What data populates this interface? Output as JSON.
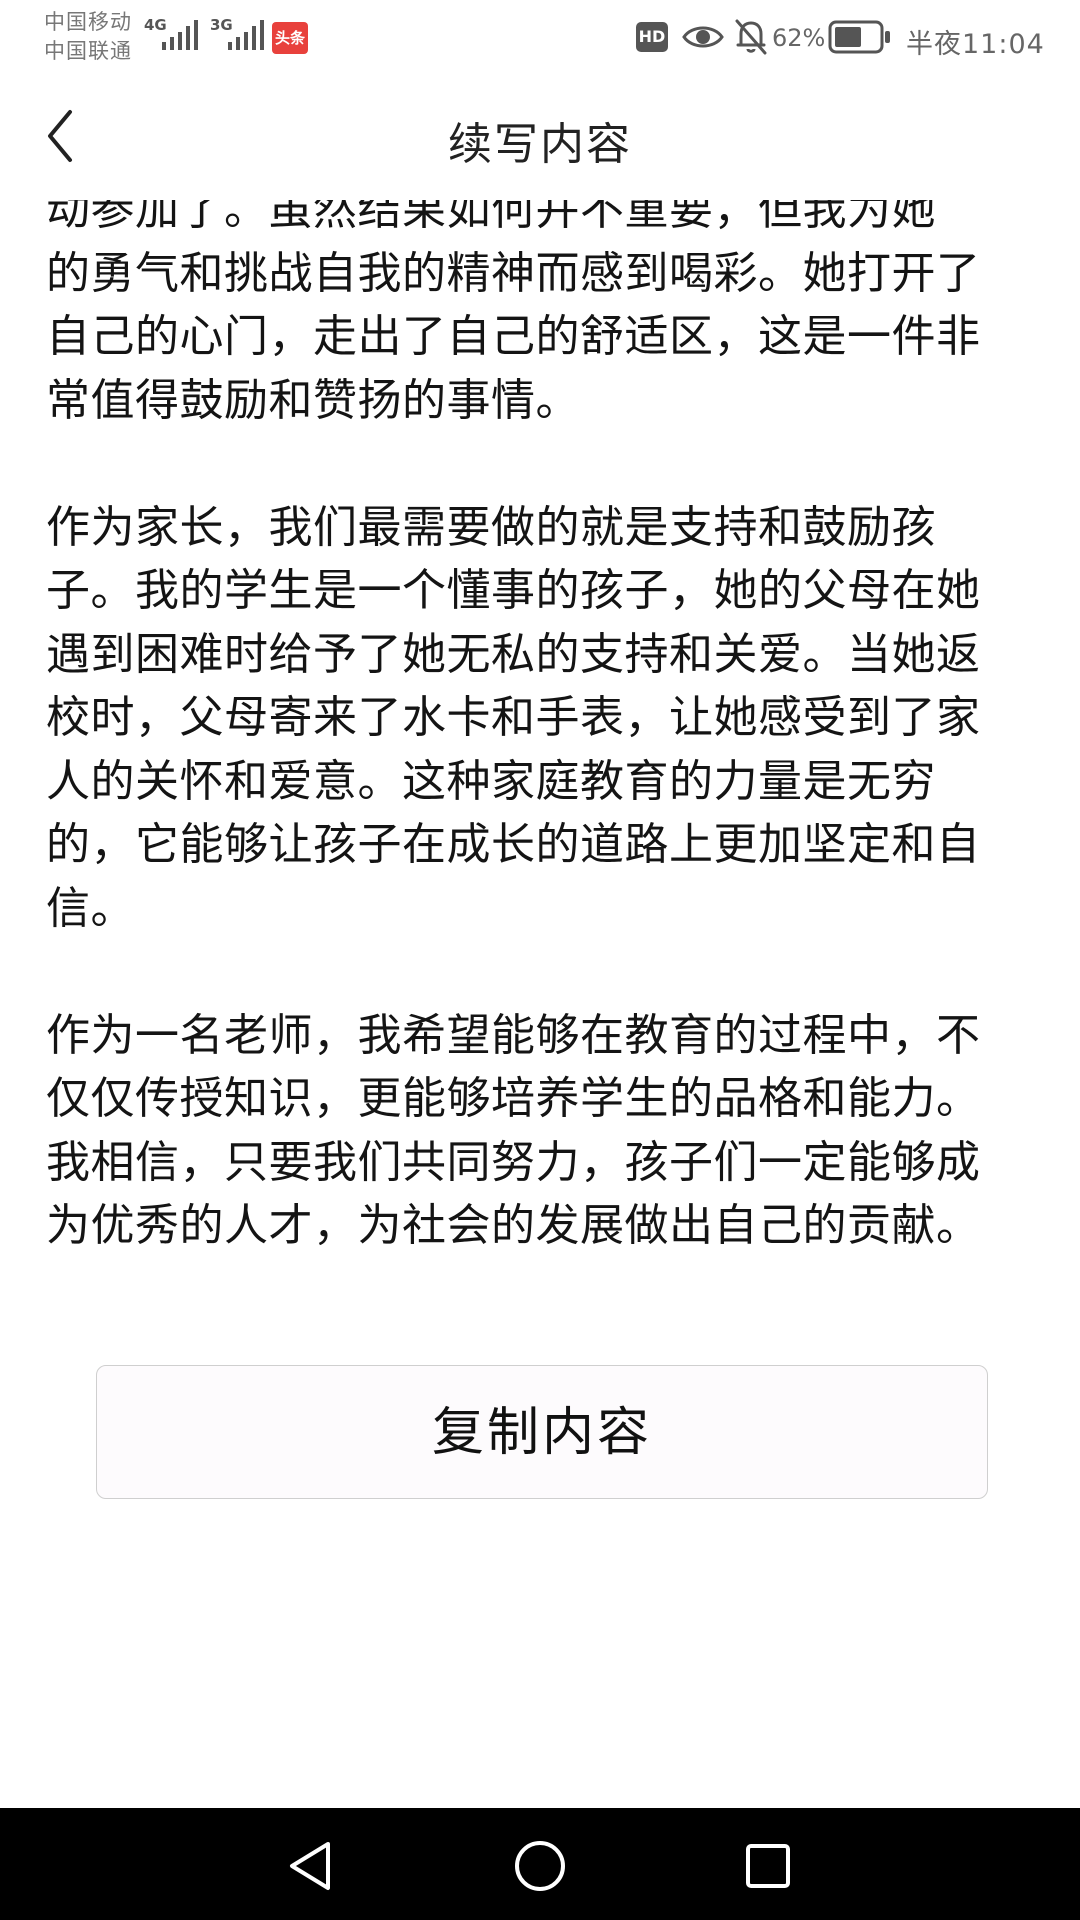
{
  "status_bar": {
    "carrier_1": "中国移动",
    "carrier_2": "中国联通",
    "network_1": "4G",
    "network_2": "3G",
    "toutiao_label": "头条",
    "hd_label": "HD",
    "battery_percent": "62%",
    "battery_level": 0.62,
    "time": "半夜11:04"
  },
  "header": {
    "title": "续写内容"
  },
  "article": {
    "first_line_cut": "动参加了。虽然结果如何并不重要，但我为她",
    "paragraph_1_rest": "的勇气和挑战自我的精神而感到喝彩。她打开了自己的心门，走出了自己的舒适区，这是一件非常值得鼓励和赞扬的事情。",
    "paragraph_2": "作为家长，我们最需要做的就是支持和鼓励孩子。我的学生是一个懂事的孩子，她的父母在她遇到困难时给予了她无私的支持和关爱。当她返校时，父母寄来了水卡和手表，让她感受到了家人的关怀和爱意。这种家庭教育的力量是无穷的，它能够让孩子在成长的道路上更加坚定和自信。",
    "paragraph_3": "作为一名老师，我希望能够在教育的过程中，不仅仅传授知识，更能够培养学生的品格和能力。我相信，只要我们共同努力，孩子们一定能够成为优秀的人才，为社会的发展做出自己的贡献。"
  },
  "actions": {
    "copy_label": "复制内容"
  },
  "icons": {
    "back": "chevron-left-icon",
    "eye": "eye-icon",
    "bell": "bell-off-icon",
    "battery": "battery-icon",
    "nav_back": "triangle-back-icon",
    "nav_home": "circle-home-icon",
    "nav_recent": "square-recent-icon"
  },
  "colors": {
    "background": "#ffffff",
    "text": "#141414",
    "button_border": "#cfcfcf",
    "nav_bar": "#000000",
    "toutiao_red": "#e8413c"
  }
}
